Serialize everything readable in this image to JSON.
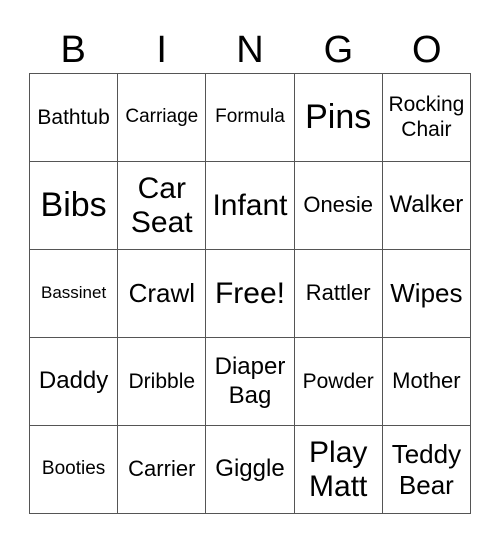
{
  "header": {
    "letters": [
      "B",
      "I",
      "N",
      "G",
      "O"
    ]
  },
  "grid": {
    "rows": [
      [
        "Bathtub",
        "Carriage",
        "Formula",
        "Pins",
        "Rocking Chair"
      ],
      [
        "Bibs",
        "Car Seat",
        "Infant",
        "Onesie",
        "Walker"
      ],
      [
        "Bassinet",
        "Crawl",
        "Free!",
        "Rattler",
        "Wipes"
      ],
      [
        "Daddy",
        "Dribble",
        "Diaper Bag",
        "Powder",
        "Mother"
      ],
      [
        "Booties",
        "Carrier",
        "Giggle",
        "Play Matt",
        "Teddy Bear"
      ]
    ]
  }
}
